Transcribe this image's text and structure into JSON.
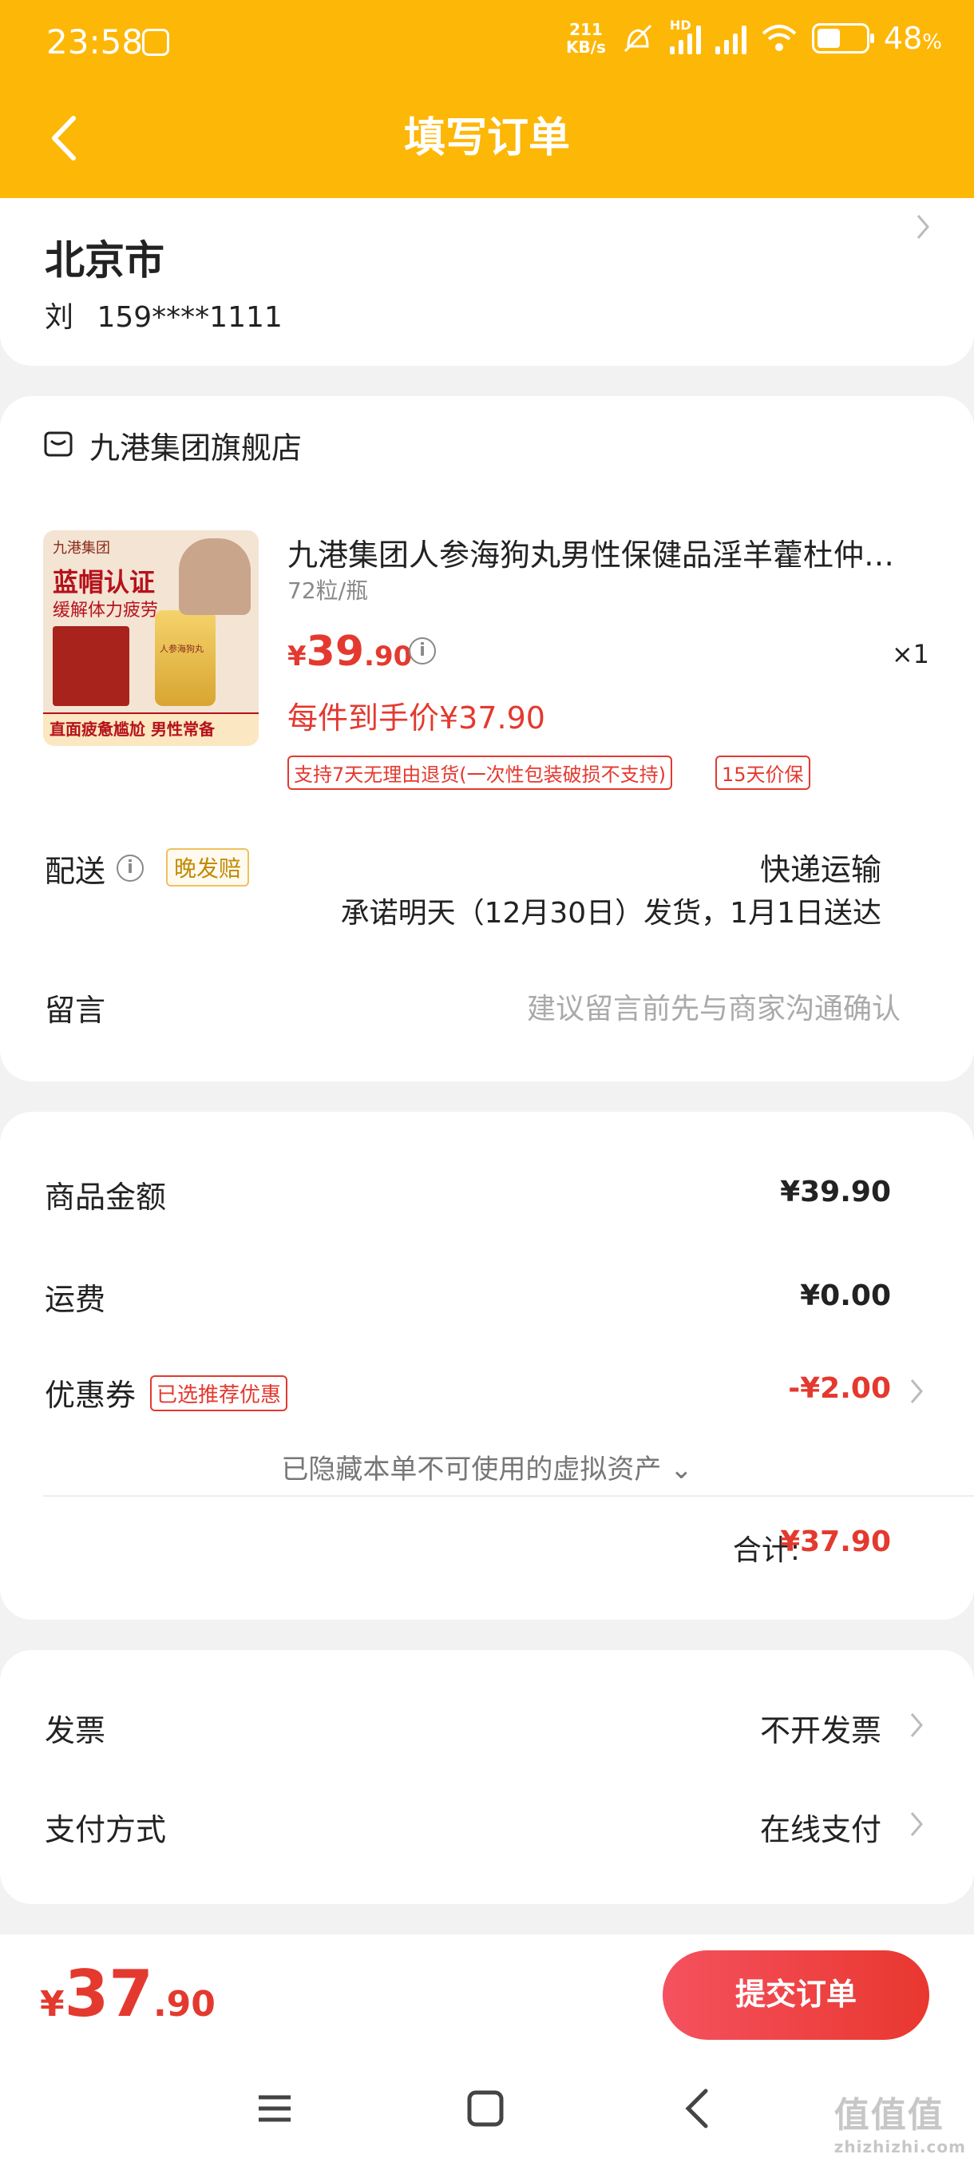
{
  "status_bar": {
    "time": "23:58",
    "net_speed_value": "211",
    "net_speed_unit": "KB/s",
    "hd": "HD",
    "battery": "48",
    "battery_unit": "%"
  },
  "header": {
    "title": "填写订单"
  },
  "address": {
    "city": "北京市",
    "name": "刘",
    "phone": "159****1111"
  },
  "store": {
    "name": "九港集团旗舰店"
  },
  "product": {
    "title": "九港集团人参海狗丸男性保健品淫羊藿杜仲…",
    "spec": "72粒/瓶",
    "price_currency": "¥",
    "price_int": "39",
    "price_dec": ".90",
    "quantity": "×1",
    "unit_price": "每件到手价¥37.90",
    "tags": [
      "支持7天无理由退货(一次性包装破损不支持)",
      "15天价保"
    ],
    "image_text": {
      "brand": "九港集团",
      "headline": "蓝帽认证",
      "sub": "缓解体力疲劳",
      "bottom": "直面疲惫尴尬 男性常备",
      "bottle": "人参海狗丸"
    }
  },
  "delivery": {
    "label": "配送",
    "late_tag": "晚发赔",
    "method": "快递运输",
    "promise": "承诺明天（12月30日）发货，1月1日送达"
  },
  "message": {
    "label": "留言",
    "placeholder": "建议留言前先与商家沟通确认"
  },
  "summary": {
    "goods_label": "商品金额",
    "goods_value": "¥39.90",
    "shipping_label": "运费",
    "shipping_value": "¥0.00",
    "coupon_label": "优惠券",
    "coupon_tag": "已选推荐优惠",
    "coupon_value": "-¥2.00",
    "hidden_assets": "已隐藏本单不可使用的虚拟资产 ⌄",
    "total_label": "合计:",
    "total_value": "¥37.90"
  },
  "invoice": {
    "label": "发票",
    "value": "不开发票",
    "pay_label": "支付方式",
    "pay_value": "在线支付"
  },
  "bottom": {
    "currency": "¥",
    "price_int": "37",
    "price_dec": ".90",
    "submit": "提交订单"
  },
  "watermark": {
    "text": "值值值",
    "url": "zhizhizhi.com"
  },
  "colors": {
    "header": "#fdb707",
    "accent_red": "#e4392f",
    "background": "#f2f2f2"
  }
}
